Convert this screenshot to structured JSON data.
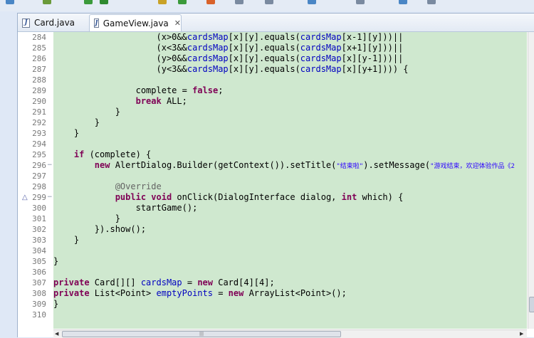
{
  "tabs": [
    {
      "label": "Card.java",
      "active": false
    },
    {
      "label": "GameView.java",
      "active": true
    }
  ],
  "tab_close_glyph": "✕",
  "java_icon_glyph": "J",
  "lines": [
    {
      "n": "284",
      "tokens": [
        [
          "p",
          "                    (x>0&&"
        ],
        [
          "f",
          "cardsMap"
        ],
        [
          "p",
          "[x][y].equals("
        ],
        [
          "f",
          "cardsMap"
        ],
        [
          "p",
          "[x-1][y]))||"
        ]
      ]
    },
    {
      "n": "285",
      "tokens": [
        [
          "p",
          "                    (x<3&&"
        ],
        [
          "f",
          "cardsMap"
        ],
        [
          "p",
          "[x][y].equals("
        ],
        [
          "f",
          "cardsMap"
        ],
        [
          "p",
          "[x+1][y]))||"
        ]
      ]
    },
    {
      "n": "286",
      "tokens": [
        [
          "p",
          "                    (y>0&&"
        ],
        [
          "f",
          "cardsMap"
        ],
        [
          "p",
          "[x][y].equals("
        ],
        [
          "f",
          "cardsMap"
        ],
        [
          "p",
          "[x][y-1]))||"
        ]
      ]
    },
    {
      "n": "287",
      "tokens": [
        [
          "p",
          "                    (y<3&&"
        ],
        [
          "f",
          "cardsMap"
        ],
        [
          "p",
          "[x][y].equals("
        ],
        [
          "f",
          "cardsMap"
        ],
        [
          "p",
          "[x][y+1]))) {"
        ]
      ]
    },
    {
      "n": "288",
      "tokens": []
    },
    {
      "n": "289",
      "tokens": [
        [
          "p",
          "                complete = "
        ],
        [
          "k",
          "false"
        ],
        [
          "p",
          ";"
        ]
      ]
    },
    {
      "n": "290",
      "tokens": [
        [
          "p",
          "                "
        ],
        [
          "k",
          "break"
        ],
        [
          "p",
          " ALL;"
        ]
      ]
    },
    {
      "n": "291",
      "tokens": [
        [
          "p",
          "            }"
        ]
      ]
    },
    {
      "n": "292",
      "tokens": [
        [
          "p",
          "        }"
        ]
      ]
    },
    {
      "n": "293",
      "tokens": [
        [
          "p",
          "    }"
        ]
      ]
    },
    {
      "n": "294",
      "tokens": []
    },
    {
      "n": "295",
      "tokens": [
        [
          "p",
          "    "
        ],
        [
          "k",
          "if"
        ],
        [
          "p",
          " (complete) {"
        ]
      ]
    },
    {
      "n": "296",
      "fold": true,
      "tokens": [
        [
          "p",
          "        "
        ],
        [
          "k",
          "new"
        ],
        [
          "p",
          " AlertDialog.Builder(getContext()).setTitle("
        ],
        [
          "s",
          "\"结束啦\""
        ],
        [
          "p",
          ").setMessage("
        ],
        [
          "s",
          "\"游戏结束，欢迎体验作品《2"
        ]
      ]
    },
    {
      "n": "297",
      "tokens": []
    },
    {
      "n": "298",
      "tokens": [
        [
          "a",
          "            @Override"
        ]
      ]
    },
    {
      "n": "299",
      "fold": true,
      "override": true,
      "tokens": [
        [
          "p",
          "            "
        ],
        [
          "k",
          "public"
        ],
        [
          "p",
          " "
        ],
        [
          "k",
          "void"
        ],
        [
          "p",
          " onClick(DialogInterface dialog, "
        ],
        [
          "k",
          "int"
        ],
        [
          "p",
          " which) {"
        ]
      ]
    },
    {
      "n": "300",
      "tokens": [
        [
          "p",
          "                startGame();"
        ]
      ]
    },
    {
      "n": "301",
      "tokens": [
        [
          "p",
          "            }"
        ]
      ]
    },
    {
      "n": "302",
      "tokens": [
        [
          "p",
          "        }).show();"
        ]
      ]
    },
    {
      "n": "303",
      "tokens": [
        [
          "p",
          "    }"
        ]
      ]
    },
    {
      "n": "304",
      "tokens": []
    },
    {
      "n": "305",
      "tokens": [
        [
          "p",
          "}"
        ]
      ]
    },
    {
      "n": "306",
      "tokens": []
    },
    {
      "n": "307",
      "tokens": [
        [
          "k",
          "private"
        ],
        [
          "p",
          " Card[][] "
        ],
        [
          "f",
          "cardsMap"
        ],
        [
          "p",
          " = "
        ],
        [
          "k",
          "new"
        ],
        [
          "p",
          " Card[4][4];"
        ]
      ]
    },
    {
      "n": "308",
      "tokens": [
        [
          "k",
          "private"
        ],
        [
          "p",
          " List<Point> "
        ],
        [
          "f",
          "emptyPoints"
        ],
        [
          "p",
          " = "
        ],
        [
          "k",
          "new"
        ],
        [
          "p",
          " ArrayList<Point>();"
        ]
      ]
    },
    {
      "n": "309",
      "tokens": [
        [
          "p",
          "}"
        ]
      ]
    },
    {
      "n": "310",
      "tokens": []
    }
  ],
  "line_indent_px": [
    {
      "n": "284",
      "x": -3
    }
  ],
  "colors": {
    "keyword": "#7f0055",
    "field": "#0000c0",
    "string": "#2a00ff",
    "annotation": "#646464",
    "editor_bg": "#cfe8cf"
  },
  "scroll_arrows": {
    "left": "◀",
    "right": "▶",
    "grip": "|||"
  }
}
